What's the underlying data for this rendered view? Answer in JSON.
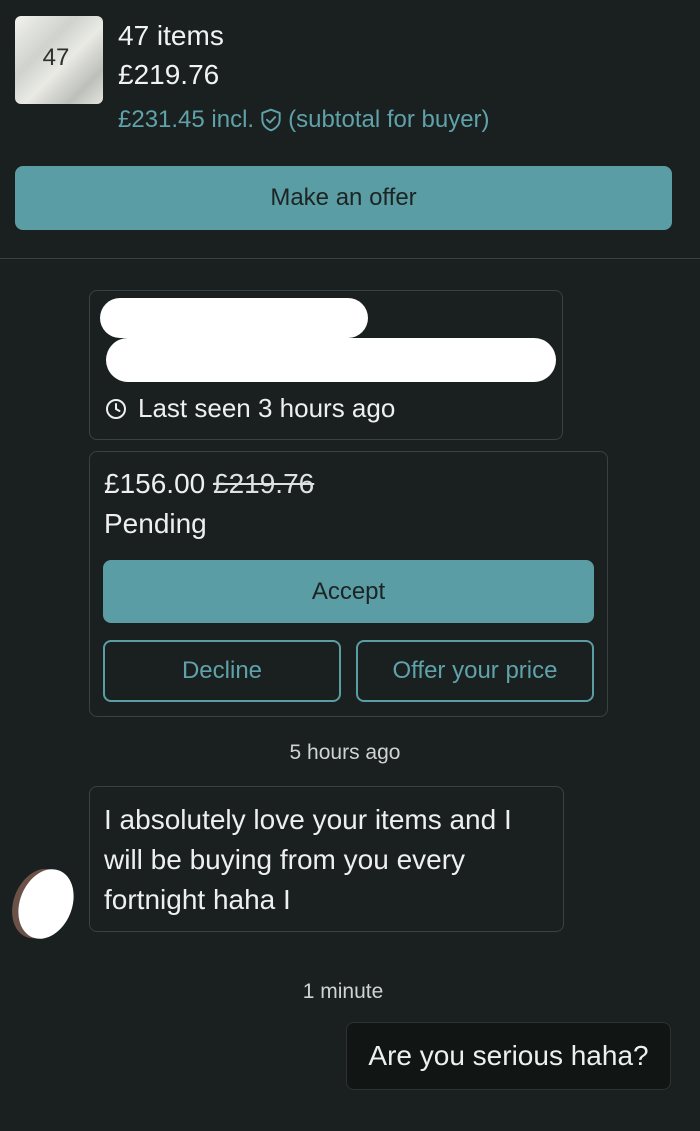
{
  "listing": {
    "thumbnail_count": "47",
    "items_count": "47 items",
    "price": "£219.76",
    "price_incl": "£231.45 incl.",
    "subtotal_note": "(subtotal for buyer)",
    "make_offer_label": "Make an offer"
  },
  "profile": {
    "last_seen": "Last seen 3 hours ago"
  },
  "offer": {
    "price": "£156.00",
    "original_price": "£219.76",
    "status": "Pending",
    "accept_label": "Accept",
    "decline_label": "Decline",
    "counter_label": "Offer your price"
  },
  "messages": [
    {
      "timestamp": "5 hours ago",
      "text": "I absolutely love your items and I will be buying from you every fortnight haha I"
    },
    {
      "timestamp": "1 minute",
      "text": "Are you serious haha?"
    }
  ],
  "colors": {
    "background": "#1a1f1f",
    "accent": "#5b9da4",
    "accent_text": "#5fa2aa"
  }
}
